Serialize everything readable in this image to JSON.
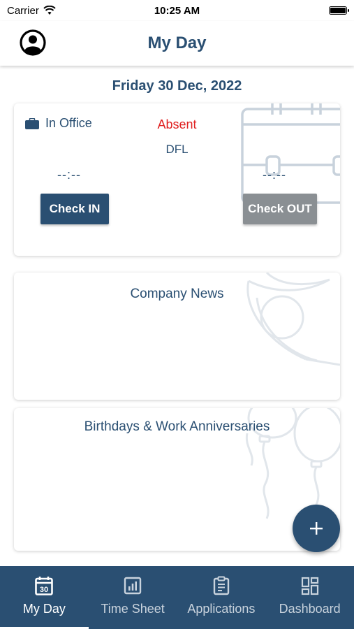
{
  "status": {
    "carrier": "Carrier",
    "time": "10:25 AM"
  },
  "header": {
    "title": "My Day"
  },
  "date": "Friday 30 Dec, 2022",
  "attendance": {
    "location": "In Office",
    "status": "Absent",
    "shift": "DFL",
    "check_in_time": "--:--",
    "check_out_time": "--:--",
    "check_in_label": "Check IN",
    "check_out_label": "Check OUT"
  },
  "news": {
    "title": "Company News"
  },
  "celebrations": {
    "title": "Birthdays & Work Anniversaries"
  },
  "fab": {
    "icon": "plus-icon"
  },
  "nav": {
    "items": [
      {
        "label": "My Day",
        "icon": "calendar-icon",
        "badge": "30"
      },
      {
        "label": "Time Sheet",
        "icon": "chart-icon"
      },
      {
        "label": "Applications",
        "icon": "clipboard-icon"
      },
      {
        "label": "Dashboard",
        "icon": "dashboard-icon"
      }
    ],
    "active": "My Day"
  },
  "colors": {
    "primary": "#2a4f72",
    "absent": "#e02020",
    "disabled": "#8a8f93"
  }
}
